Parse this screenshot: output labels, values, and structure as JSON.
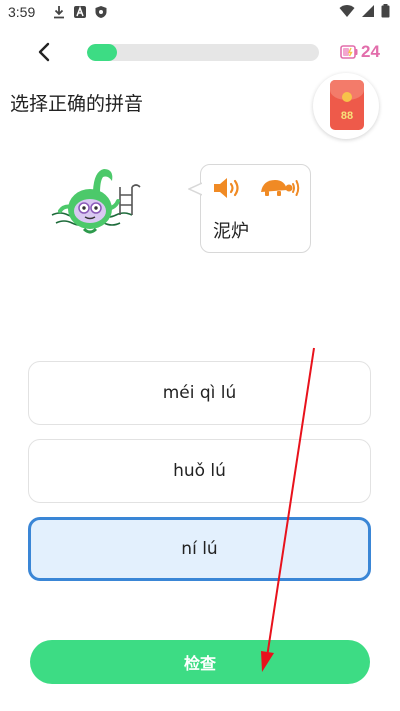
{
  "status_bar": {
    "time": "3:59"
  },
  "header": {
    "progress_fraction": 0.13,
    "energy_count": "24"
  },
  "question": {
    "prompt": "选择正确的拼音",
    "word": "泥炉"
  },
  "reward": {
    "amount": "88"
  },
  "options": [
    {
      "label": "méi qì lú",
      "selected": false
    },
    {
      "label": "huǒ lú",
      "selected": false
    },
    {
      "label": "ní lú",
      "selected": true
    }
  ],
  "actions": {
    "check_label": "检查"
  },
  "colors": {
    "accent_green": "#3ddc84",
    "selected_border": "#3a86d6",
    "selected_bg": "#e3f0fd",
    "audio_orange": "#f08a24",
    "energy_pink": "#e26dab",
    "annotation_red": "#e8121c"
  },
  "icons": [
    "download-icon",
    "a-badge-icon",
    "shield-icon",
    "wifi-icon",
    "signal-icon",
    "battery-icon",
    "back-arrow-icon",
    "energy-battery-icon",
    "red-packet-icon",
    "mascot-icon",
    "speaker-icon",
    "turtle-slow-icon"
  ]
}
